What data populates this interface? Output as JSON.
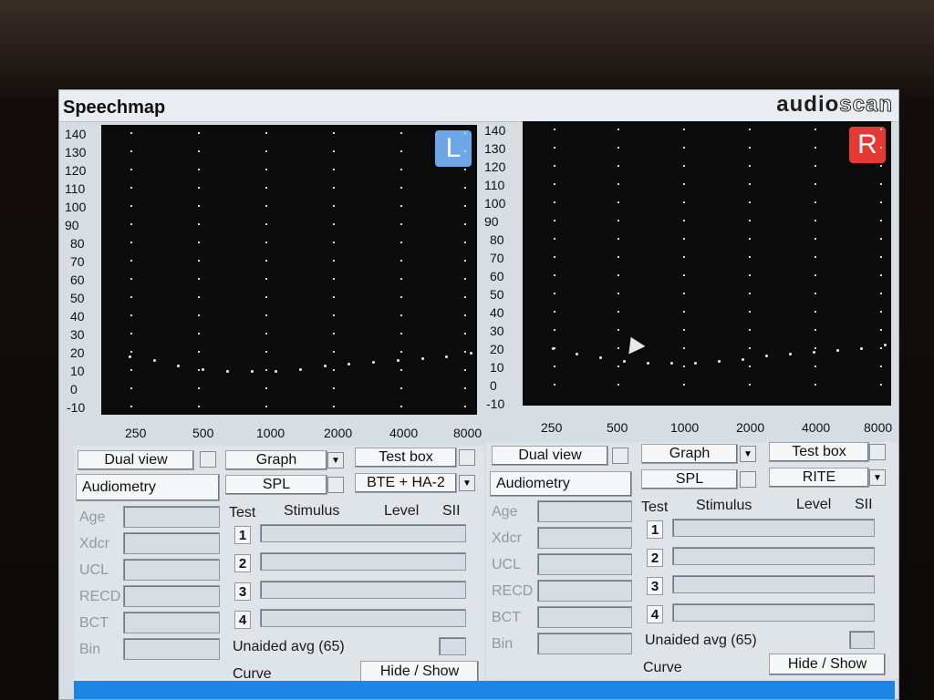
{
  "window": {
    "title": "Speechmap",
    "logo_left": "audio",
    "logo_right": "scan"
  },
  "graph": {
    "y_ticks": [
      "140",
      "130",
      "120",
      "110",
      "100",
      "90",
      "80",
      "70",
      "60",
      "50",
      "40",
      "30",
      "20",
      "10",
      "0",
      "-10"
    ],
    "x_ticks": [
      "250",
      "500",
      "1000",
      "2000",
      "4000",
      "8000"
    ],
    "left_badge": "L",
    "right_badge": "R",
    "left_curve": [
      18,
      16,
      13,
      11,
      10,
      10,
      10,
      11,
      13,
      14,
      15,
      16,
      17,
      18,
      20
    ],
    "right_curve": [
      18,
      15,
      13,
      11,
      10,
      10,
      10,
      11,
      12,
      14,
      15,
      16,
      17,
      18,
      20
    ]
  },
  "left_panel": {
    "dual_view": "Dual view",
    "audiometry": "Audiometry",
    "labels": [
      "Age",
      "Xdcr",
      "UCL",
      "RECD",
      "BCT",
      "Bin"
    ],
    "graph": "Graph",
    "spl": "SPL",
    "test_box": "Test box",
    "coupler": "BTE + HA-2",
    "headers": {
      "test": "Test",
      "stimulus": "Stimulus",
      "level": "Level",
      "sii": "SII"
    },
    "tests": [
      "1",
      "2",
      "3",
      "4"
    ],
    "unaided": "Unaided avg (65)",
    "curve": "Curve",
    "hide_show": "Hide / Show"
  },
  "right_panel": {
    "dual_view": "Dual view",
    "audiometry": "Audiometry",
    "labels": [
      "Age",
      "Xdcr",
      "UCL",
      "RECD",
      "BCT",
      "Bin"
    ],
    "graph": "Graph",
    "spl": "SPL",
    "test_box": "Test box",
    "coupler": "RITE",
    "headers": {
      "test": "Test",
      "stimulus": "Stimulus",
      "level": "Level",
      "sii": "SII"
    },
    "tests": [
      "1",
      "2",
      "3",
      "4"
    ],
    "unaided": "Unaided avg (65)",
    "curve": "Curve",
    "hide_show": "Hide / Show"
  },
  "colors": {
    "left_badge": "#6da7e8",
    "right_badge": "#e53a34"
  }
}
